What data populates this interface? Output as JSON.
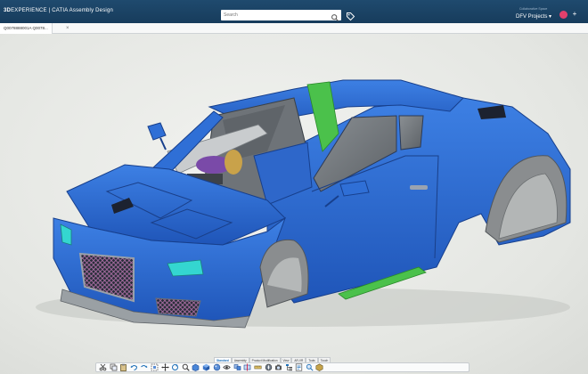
{
  "titlebar": {
    "brand_bold": "3D",
    "brand_rest": "EXPERIENCE | CATIA Assembly Design",
    "search_placeholder": "Search",
    "user_subtitle": "Collaborative Space",
    "user_name": "DFV Projects"
  },
  "document_tab": {
    "label": "Q0078888001A Q0078..."
  },
  "action_bar": {
    "tabs": [
      "Standard",
      "Assembly",
      "Product Modification",
      "View",
      "AR-VR",
      "Tools",
      "Touch"
    ],
    "active_tab": "Standard",
    "tools": [
      "cut-icon",
      "copy-icon",
      "paste-icon",
      "undo-icon",
      "redo-icon",
      "fit-all-icon",
      "pan-icon",
      "rotate-icon",
      "zoom-icon",
      "normal-view-icon",
      "isometric-view-icon",
      "render-style-icon",
      "hide-show-icon",
      "swap-space-icon",
      "section-icon",
      "measure-icon",
      "compass-icon",
      "snapshot-icon",
      "tree-icon",
      "properties-icon",
      "search-tool-icon",
      "product-icon"
    ]
  },
  "colors": {
    "titlebar": "#1f4a6e",
    "car_body": "#2f6fd6",
    "accent_green": "#4bc14b",
    "headlight": "#34d6d0",
    "avatar": "#e2406c"
  }
}
